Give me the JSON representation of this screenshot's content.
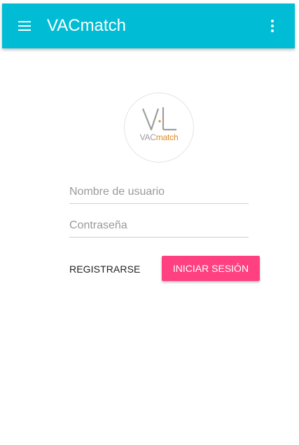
{
  "appbar": {
    "title": "VACmatch",
    "menu_icon": "menu-icon",
    "more_icon": "more-vert-icon",
    "color": "#00bcd4"
  },
  "logo": {
    "text_vac": "VAC",
    "text_match": "match",
    "vac_color": "#9e9e9e",
    "match_color": "#e08a1e"
  },
  "form": {
    "username_placeholder": "Nombre de usuario",
    "username_value": "",
    "password_placeholder": "Contraseña",
    "password_value": ""
  },
  "actions": {
    "register_label": "REGISTRARSE",
    "login_label": "INICIAR SESIÓN",
    "login_color": "#ff4081"
  }
}
